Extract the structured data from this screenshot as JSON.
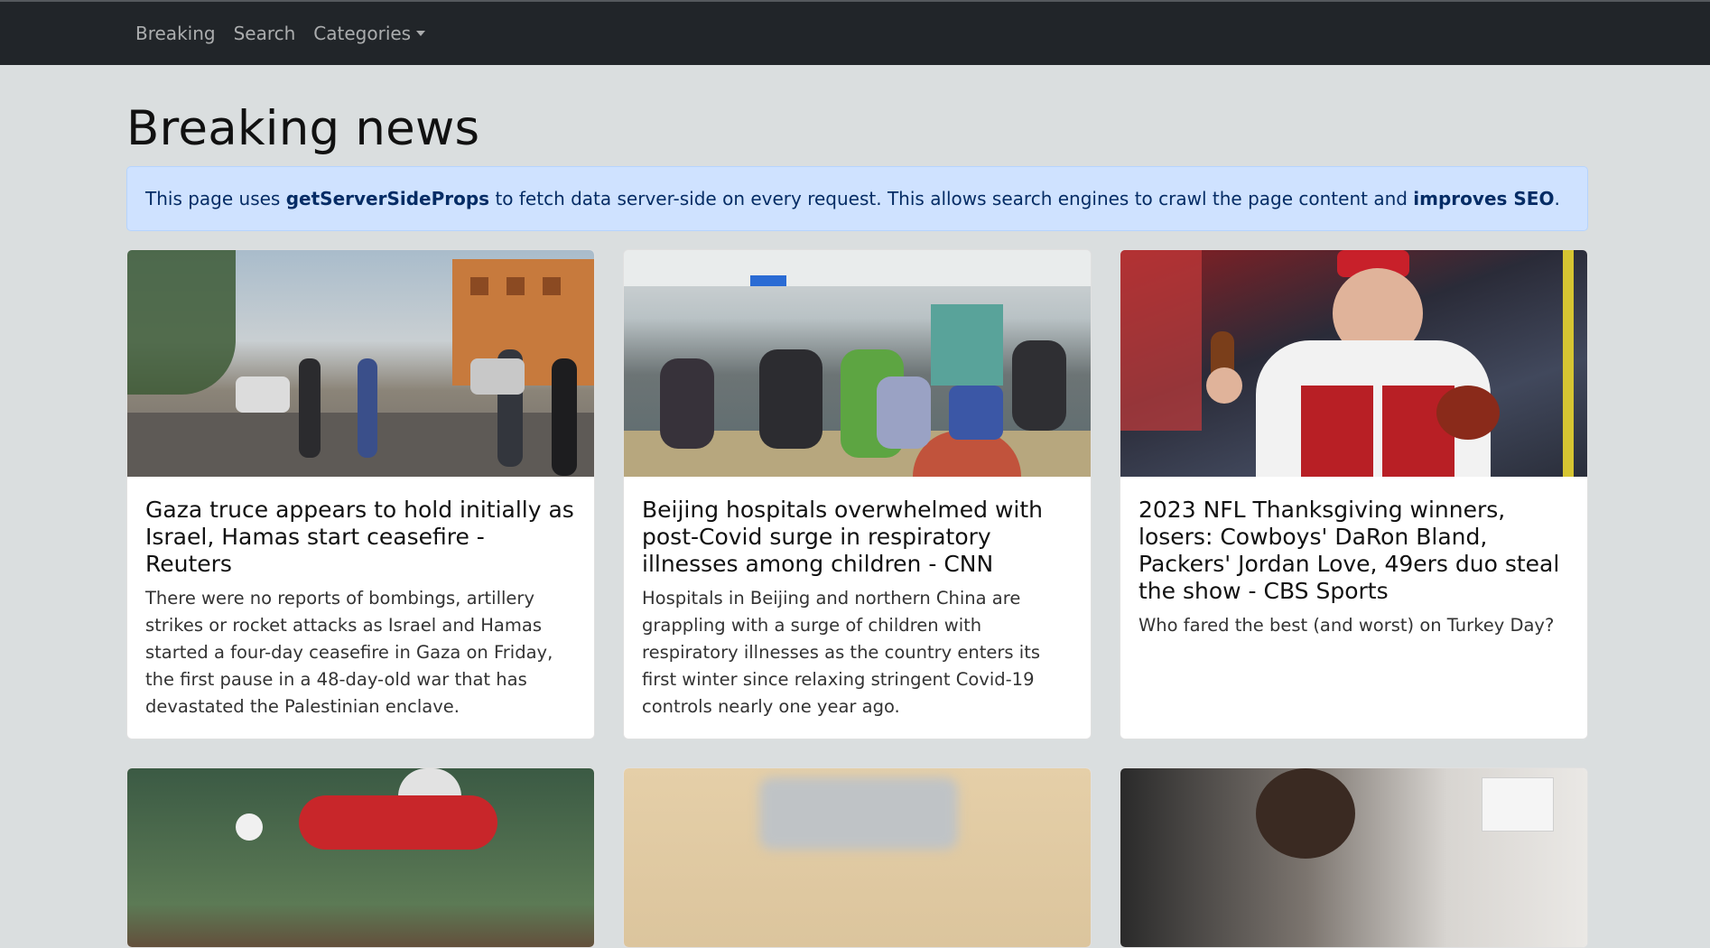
{
  "navbar": {
    "items": [
      {
        "label": "Breaking"
      },
      {
        "label": "Search"
      },
      {
        "label": "Categories"
      }
    ]
  },
  "page": {
    "title": "Breaking news"
  },
  "alert": {
    "prefix": "This page uses ",
    "strong1": "getServerSideProps",
    "middle": " to fetch data server-side on every request. This allows search engines to crawl the page content and ",
    "strong2": "improves SEO",
    "suffix": "."
  },
  "articles": [
    {
      "title": "Gaza truce appears to hold initially as Israel, Hamas start ceasefire - Reuters",
      "description": "There were no reports of bombings, artillery strikes or rocket attacks as Israel and Hamas started a four-day ceasefire in Gaza on Friday, the first pause in a 48-day-old war that has devastated the Palestinian enclave."
    },
    {
      "title": "Beijing hospitals overwhelmed with post-Covid surge in respiratory illnesses among children - CNN",
      "description": "Hospitals in Beijing and northern China are grappling with a surge of children with respiratory illnesses as the country enters its first winter since relaxing stringent Covid-19 controls nearly one year ago."
    },
    {
      "title": "2023 NFL Thanksgiving winners, losers: Cowboys' DaRon Bland, Packers' Jordan Love, 49ers duo steal the show - CBS Sports",
      "description": "Who fared the best (and worst) on Turkey Day?"
    }
  ]
}
